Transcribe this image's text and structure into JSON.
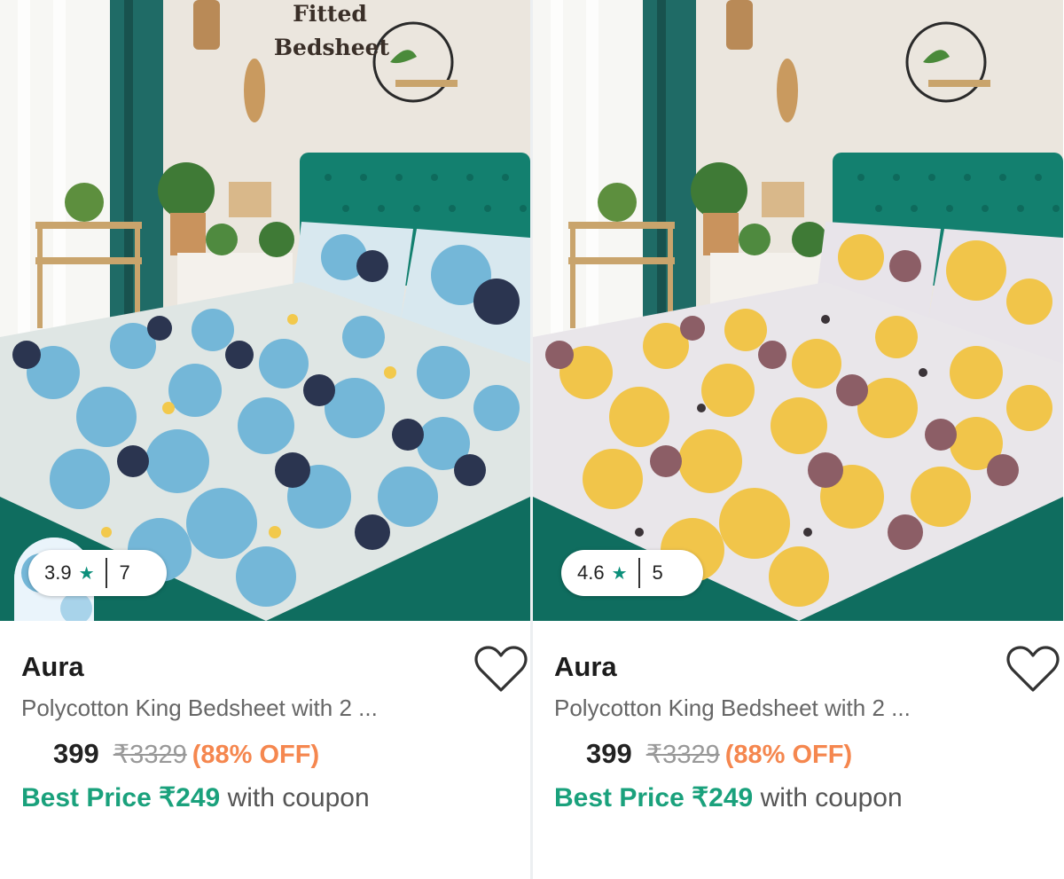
{
  "products": [
    {
      "overlay_text": [
        "Fitted",
        "Bedsheet"
      ],
      "rating": "3.9",
      "reviews": "7",
      "brand": "Aura",
      "title": "Polycotton King Bedsheet with 2 ...",
      "price": "399",
      "mrp": "₹3329",
      "discount": "(88% OFF)",
      "best_price_label": "Best Price ₹249",
      "best_price_tail": " with coupon",
      "sheet_color": "#74b7d8"
    },
    {
      "rating": "4.6",
      "reviews": "5",
      "brand": "Aura",
      "title": "Polycotton King Bedsheet with 2 ...",
      "price": "399",
      "mrp": "₹3329",
      "discount": "(88% OFF)",
      "best_price_label": "Best Price ₹249",
      "best_price_tail": " with coupon",
      "sheet_color": "#f1c54a"
    }
  ],
  "icons": {
    "star": "star-icon",
    "wishlist": "heart-icon"
  },
  "colors": {
    "accent_green": "#1aa17c",
    "discount_orange": "#f5874f",
    "rating_star": "#0b8f7a",
    "headboard": "#13806f"
  }
}
